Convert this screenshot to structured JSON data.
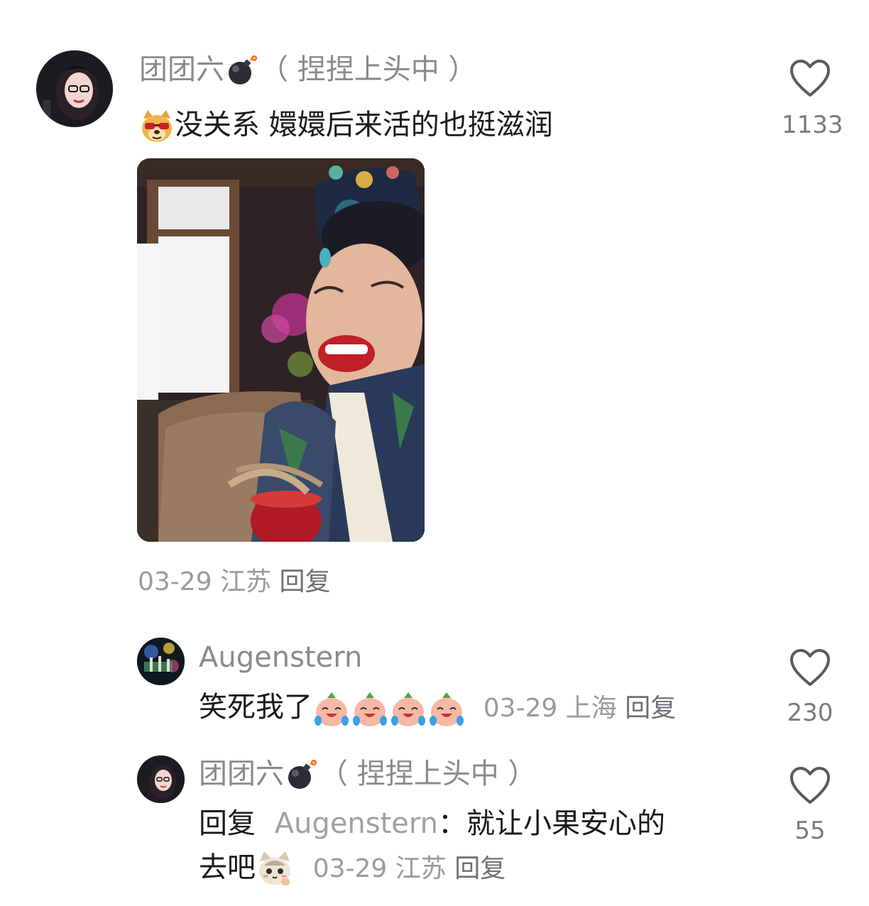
{
  "comments": [
    {
      "username": "团团六",
      "username_suffix": "（ 捏捏上头中 ）",
      "badge_emoji": "bomb",
      "emoji_prefix": "dog-face-glasses",
      "text": "没关系 嬛嬛后来活的也挺滋润",
      "has_image": true,
      "date": "03-29",
      "location": "江苏",
      "reply_label": "回复",
      "likes": "1133"
    },
    {
      "username": "Augenstern",
      "text": "笑死我了",
      "trailing_emojis": [
        "laughing-peach",
        "laughing-peach",
        "laughing-peach",
        "laughing-peach"
      ],
      "date": "03-29",
      "location": "上海",
      "reply_label": "回复",
      "likes": "230"
    },
    {
      "username": "团团六",
      "username_suffix": "（ 捏捏上头中 ）",
      "badge_emoji": "bomb",
      "reply_prefix": "回复",
      "reply_to": "Augenstern",
      "reply_colon": "：",
      "text_line1": "就让小果安心的",
      "text_line2": "去吧",
      "trailing_emoji": "cat-face",
      "date": "03-29",
      "location": "江苏",
      "reply_label": "回复",
      "likes": "55"
    }
  ],
  "colors": {
    "username": "#8a8a8f",
    "text": "#1a1a1a",
    "meta": "#9a9aa0",
    "heart_outline": "#5a5a60"
  }
}
